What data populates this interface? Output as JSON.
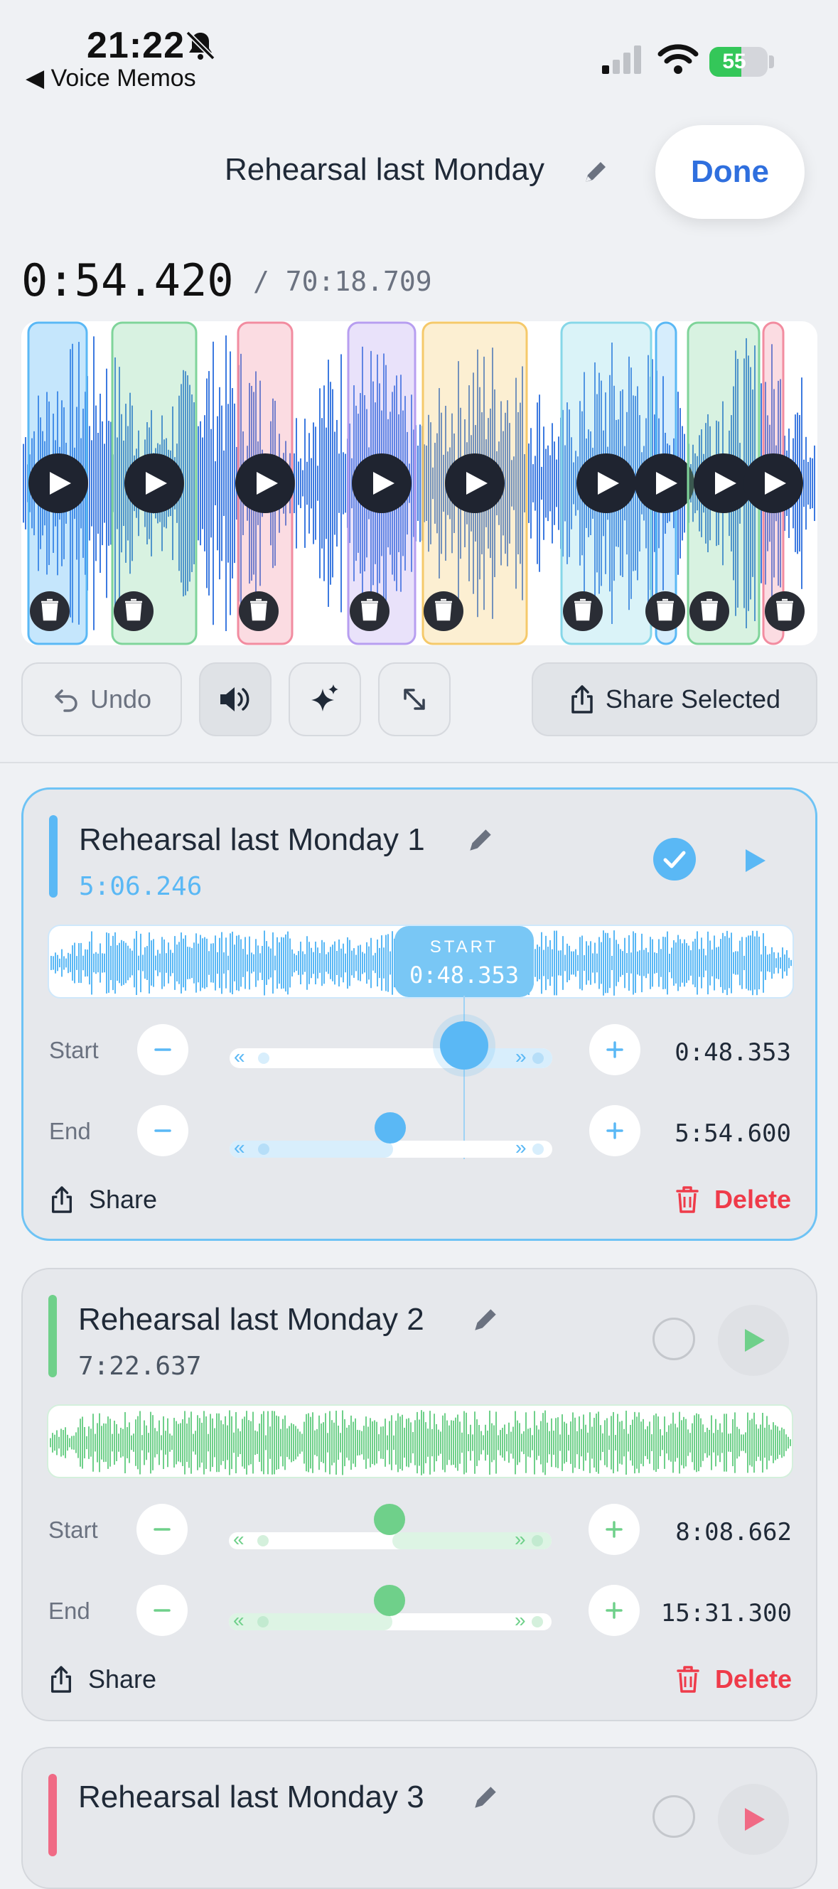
{
  "status_bar": {
    "time": "21:22",
    "back_label": "◀ Voice Memos",
    "battery": "55",
    "battery_level": 55
  },
  "header": {
    "title": "Rehearsal last Monday",
    "done_label": "Done"
  },
  "playback": {
    "position": "0:54.420",
    "duration": "/ 70:18.709"
  },
  "toolbar": {
    "undo_label": "Undo",
    "share_selected_label": "Share Selected"
  },
  "clips": [
    {
      "name": "Rehearsal last Monday 1",
      "duration": "5:06.246",
      "selected": true,
      "color": "#5ab8f5",
      "tooltip_label": "START",
      "tooltip_value": "0:48.353",
      "start_label": "Start",
      "start_value": "0:48.353",
      "end_label": "End",
      "end_value": "5:54.600",
      "share_label": "Share",
      "delete_label": "Delete"
    },
    {
      "name": "Rehearsal last Monday 2",
      "duration": "7:22.637",
      "selected": false,
      "color": "#6fd08a",
      "start_label": "Start",
      "start_value": "8:08.662",
      "end_label": "End",
      "end_value": "15:31.300",
      "share_label": "Share",
      "delete_label": "Delete"
    },
    {
      "name": "Rehearsal last Monday 3",
      "color": "#f06a85"
    }
  ],
  "colors": {
    "accent": "#2f6fde",
    "delete": "#ef3b4a",
    "waveform": "#3d7ae0"
  }
}
